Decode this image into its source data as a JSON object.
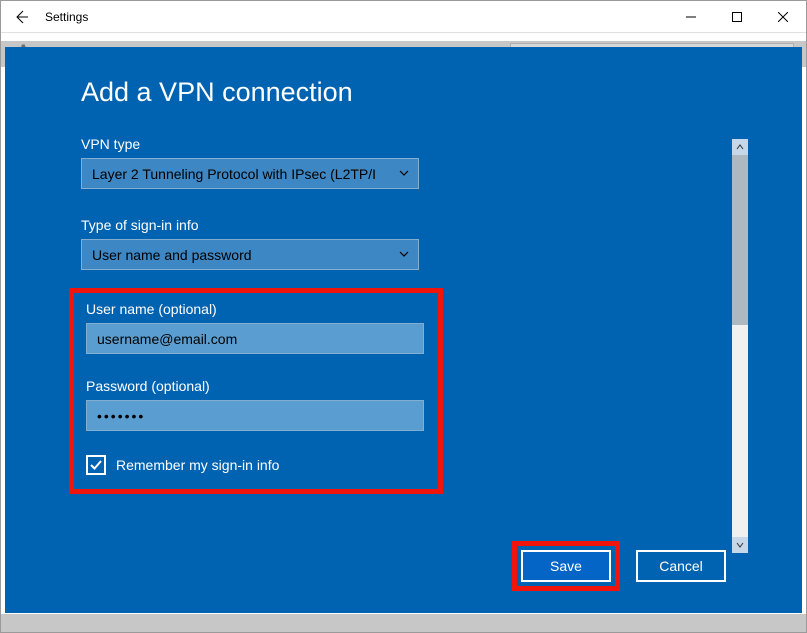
{
  "window": {
    "title": "Settings"
  },
  "dialog": {
    "title": "Add a VPN connection",
    "vpn_type_label": "VPN type",
    "vpn_type_value": "Layer 2 Tunneling Protocol with IPsec (L2TP/I",
    "signin_type_label": "Type of sign-in info",
    "signin_type_value": "User name and password",
    "username_label": "User name (optional)",
    "username_value": "username@email.com",
    "password_label": "Password (optional)",
    "password_value": "•••••••",
    "remember_label": "Remember my sign-in info",
    "remember_checked": true,
    "save_label": "Save",
    "cancel_label": "Cancel"
  }
}
